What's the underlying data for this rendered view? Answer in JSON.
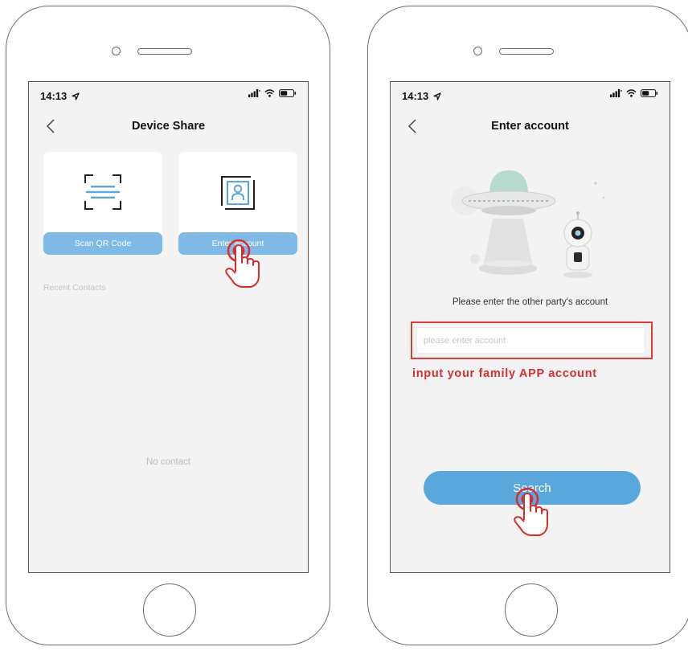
{
  "left_phone": {
    "status_bar": {
      "time": "14:13"
    },
    "nav": {
      "title": "Device Share"
    },
    "cards": {
      "scan_label": "Scan QR Code",
      "enter_label": "Enter account"
    },
    "recent_contacts_label": "Recent Contacts",
    "empty_state": "No contact"
  },
  "right_phone": {
    "status_bar": {
      "time": "14:13"
    },
    "nav": {
      "title": "Enter account"
    },
    "prompt": "Please enter the other party's account",
    "account_input": {
      "placeholder": "please enter account",
      "value": ""
    },
    "annotation": "input your family APP account",
    "search_label": "Search"
  },
  "colors": {
    "accent_blue": "#5aa7db",
    "light_blue_button": "#7fb9e5",
    "annotation_red": "#d92e2e",
    "screen_bg": "#f3f3f3"
  },
  "icons": [
    "location-arrow-icon",
    "signal-icon",
    "wifi-icon",
    "battery-icon",
    "back-chevron-icon",
    "qr-scan-icon",
    "contact-card-icon",
    "tap-hand-icon",
    "ufo-robot-illustration"
  ]
}
